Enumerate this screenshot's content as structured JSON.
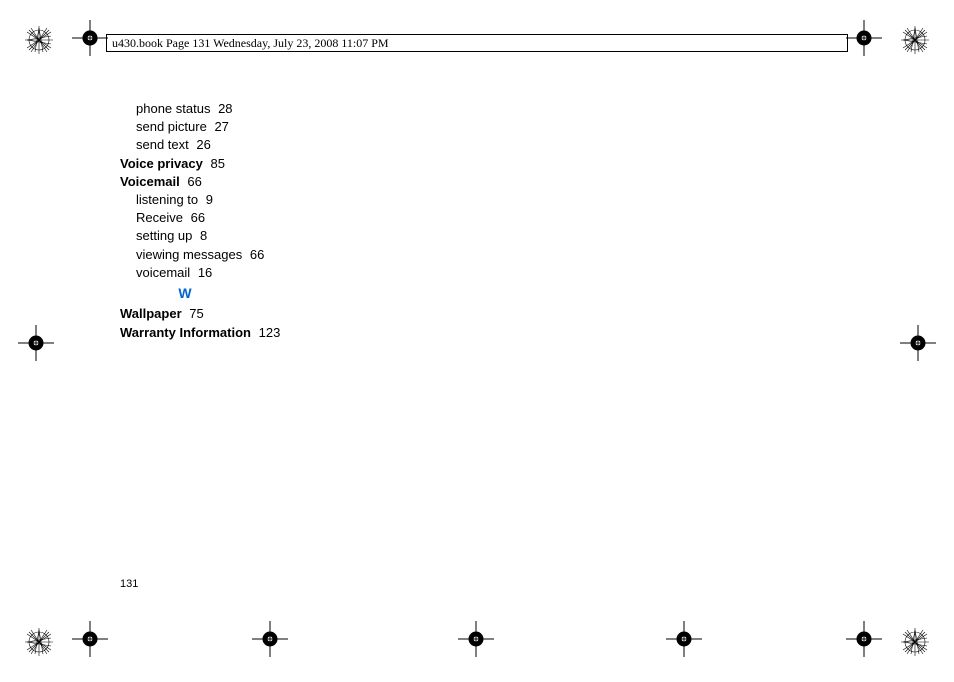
{
  "header": {
    "text": "u430.book  Page 131  Wednesday, July 23, 2008  11:07 PM"
  },
  "index": {
    "entries": [
      {
        "label": "phone status",
        "page": "28",
        "bold": false,
        "sub": true
      },
      {
        "label": "send picture",
        "page": "27",
        "bold": false,
        "sub": true
      },
      {
        "label": "send text",
        "page": "26",
        "bold": false,
        "sub": true
      },
      {
        "label": "Voice privacy",
        "page": "85",
        "bold": true,
        "sub": false
      },
      {
        "label": "Voicemail",
        "page": "66",
        "bold": true,
        "sub": false
      },
      {
        "label": "listening to",
        "page": "9",
        "bold": false,
        "sub": true
      },
      {
        "label": "Receive",
        "page": "66",
        "bold": false,
        "sub": true
      },
      {
        "label": "setting up",
        "page": "8",
        "bold": false,
        "sub": true
      },
      {
        "label": "viewing messages",
        "page": "66",
        "bold": false,
        "sub": true
      },
      {
        "label": "voicemail",
        "page": "16",
        "bold": false,
        "sub": true
      }
    ],
    "section_letter": "W",
    "entries_after": [
      {
        "label": "Wallpaper",
        "page": "75",
        "bold": true,
        "sub": false
      },
      {
        "label": "Warranty Information",
        "page": "123",
        "bold": true,
        "sub": false
      }
    ]
  },
  "page_number": "131"
}
